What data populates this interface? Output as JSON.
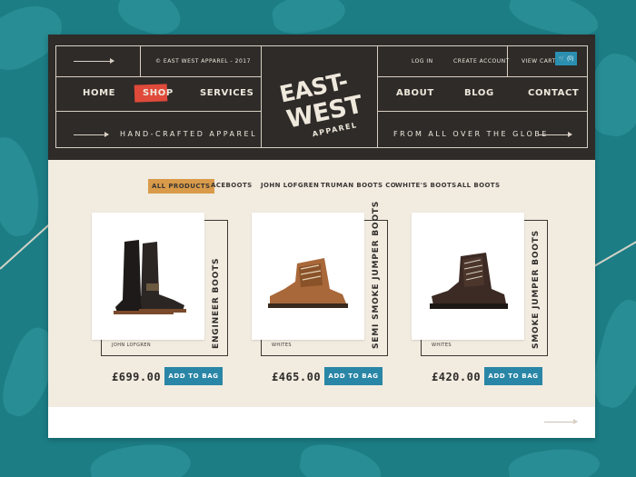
{
  "header": {
    "copyright": "© EAST WEST APPAREL - 2017",
    "login_label": "LOG IN",
    "create_account_label": "CREATE ACCOUNT",
    "view_cart_label": "VIEW CART",
    "cart_count": "(0)",
    "nav_left": [
      "HOME",
      "SHOP",
      "SERVICES"
    ],
    "nav_right": [
      "ABOUT",
      "BLOG",
      "CONTACT"
    ],
    "tagline_left": "HAND-CRAFTED APPAREL",
    "tagline_right": "FROM ALL OVER THE GLOBE",
    "logo_line1": "EAST-",
    "logo_line2": "WEST",
    "logo_line3": "APPAREL"
  },
  "filters": [
    "ALL PRODUCTS",
    "ACEBOOTS",
    "JOHN LOFGREN",
    "TRUMAN BOOTS CO",
    "WHITE'S BOOTS",
    "ALL BOOTS"
  ],
  "products": [
    {
      "title": "ENGINEER BOOTS",
      "brand": "JOHN LOFGREN",
      "price": "£699.00",
      "button": "ADD TO BAG"
    },
    {
      "title": "SEMI SMOKE JUMPER BOOTS",
      "brand": "WHITES",
      "price": "£465.00",
      "button": "ADD TO BAG"
    },
    {
      "title": "SMOKE JUMPER BOOTS",
      "brand": "WHITES",
      "price": "£420.00",
      "button": "ADD TO BAG"
    }
  ],
  "colors": {
    "background": "#1c7d85",
    "header": "#2e2b29",
    "page": "#f1ebe0",
    "shop_highlight": "#e04a3a",
    "filter_highlight": "#d99b4a",
    "button": "#2a86a6"
  },
  "icons": [
    "arrow-icon",
    "cart-icon"
  ]
}
